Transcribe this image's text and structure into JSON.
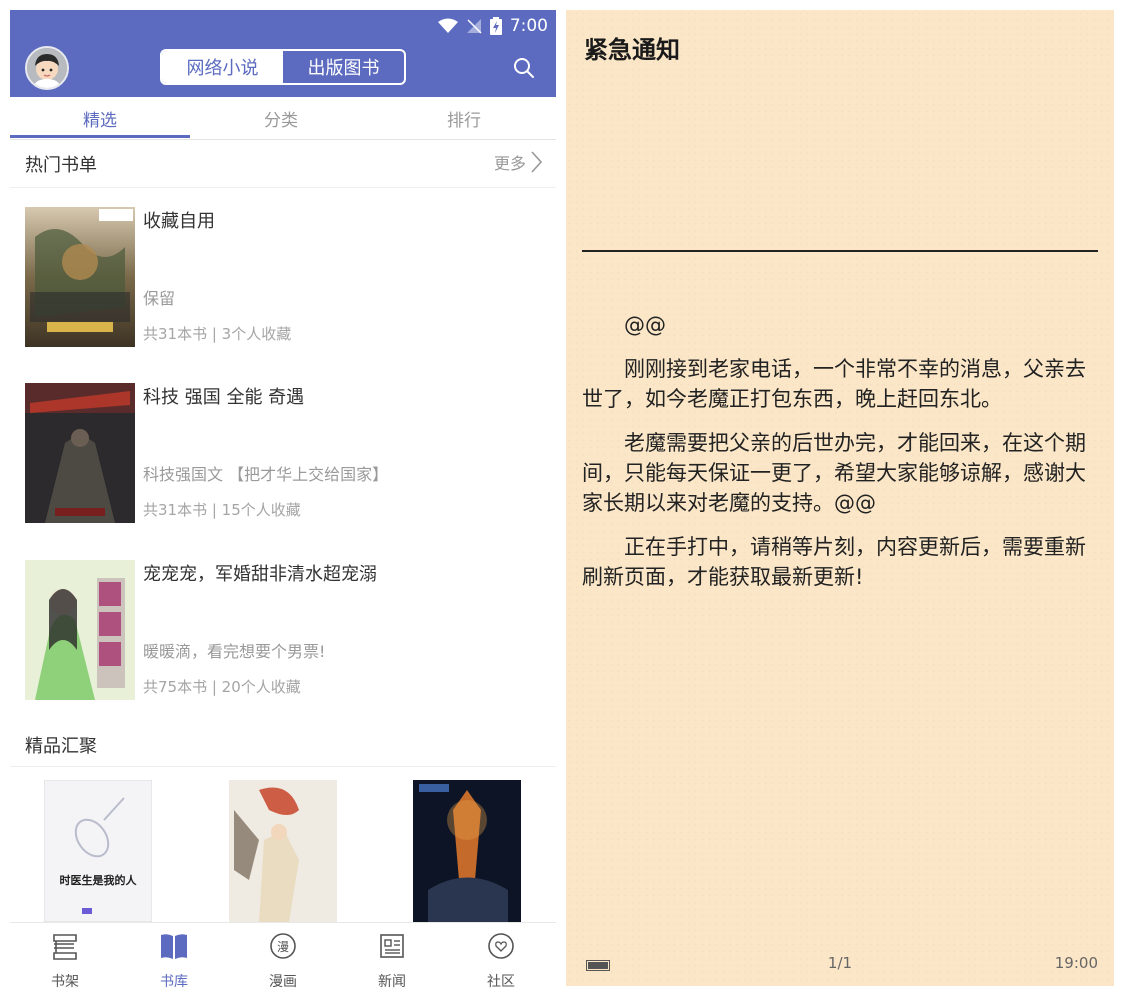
{
  "status_bar": {
    "time": "7:00"
  },
  "header": {
    "segments": [
      "网络小说",
      "出版图书"
    ],
    "active_segment": 0
  },
  "tabs": [
    "精选",
    "分类",
    "排行"
  ],
  "hot_lists": {
    "title": "热门书单",
    "more_label": "更多"
  },
  "books": [
    {
      "title": "收藏自用",
      "desc": "保留",
      "meta": "共31本书 | 3个人收藏"
    },
    {
      "title": "科技 强国 全能 奇遇",
      "desc": "科技强国文 【把才华上交给国家】",
      "meta": "共31本书 | 15个人收藏"
    },
    {
      "title": "宠宠宠，军婚甜非清水超宠溺",
      "desc": "暖暖滴，看完想要个男票!",
      "meta": "共75本书 | 20个人收藏"
    }
  ],
  "premium": {
    "title": "精品汇聚",
    "covers": [
      {
        "title": "时医生是我的人"
      },
      {
        "title": ""
      },
      {
        "title": ""
      }
    ]
  },
  "bottom_nav": [
    {
      "label": "书架",
      "icon": "bookshelf-icon"
    },
    {
      "label": "书库",
      "icon": "library-book-icon"
    },
    {
      "label": "漫画",
      "icon": "comic-icon"
    },
    {
      "label": "新闻",
      "icon": "news-icon"
    },
    {
      "label": "社区",
      "icon": "community-icon"
    }
  ],
  "notice": {
    "title": "紧急通知",
    "paragraphs": [
      "@@",
      "刚刚接到老家电话，一个非常不幸的消息，父亲去世了，如今老魔正打包东西，晚上赶回东北。",
      "老魔需要把父亲的后世办完，才能回来，在这个期间，只能每天保证一更了，希望大家能够谅解，感谢大家长期以来对老魔的支持。@@",
      "正在手打中，请稍等片刻，内容更新后，需要重新刷新页面，才能获取最新更新!"
    ],
    "page": "1/1",
    "clock": "19:00"
  },
  "colors": {
    "primary": "#5c6bbf",
    "reader_bg": "#fbe7c8"
  }
}
